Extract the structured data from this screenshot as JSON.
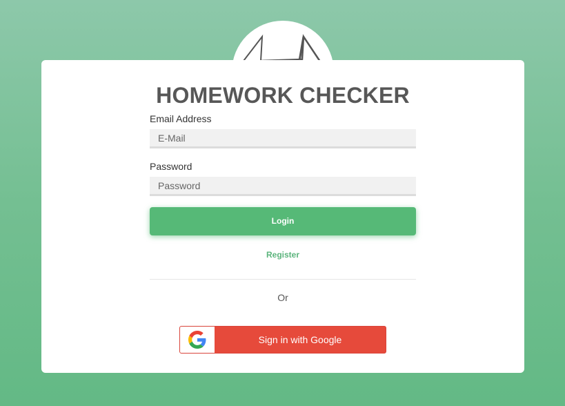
{
  "app": {
    "title": "HOMEWORK CHECKER",
    "logo_icon": "book-pyramid-icon"
  },
  "form": {
    "email": {
      "label": "Email Address",
      "placeholder": "E-Mail",
      "value": ""
    },
    "password": {
      "label": "Password",
      "placeholder": "Password",
      "value": ""
    },
    "login_label": "Login",
    "register_label": "Register",
    "separator_text": "Or",
    "google_label": "Sign in with Google",
    "google_icon": "google-g-icon"
  },
  "colors": {
    "background_top": "#8dc8aa",
    "background_bottom": "#63b985",
    "accent_green": "#56b977",
    "google_red": "#e64a3b",
    "title_gray": "#575757"
  }
}
